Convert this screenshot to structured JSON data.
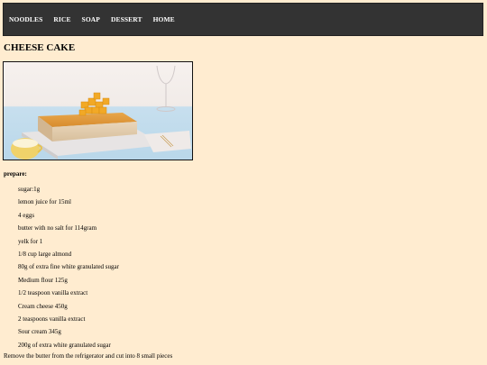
{
  "nav": {
    "items": [
      "NOODLES",
      "RICE",
      "SOAP",
      "DESSERT",
      "HOME"
    ]
  },
  "page": {
    "title": "CHEESE CAKE",
    "image_alt": "cheese cake with mango cubes on a marble board"
  },
  "prepare": {
    "label": "prepare:",
    "ingredients": [
      "sugar:1g",
      "lemon juice for 15ml",
      "4 eggs",
      "butter with no salt for 114gram",
      "yelk for 1",
      "1/8 cup large almond",
      "80g of extra fine white granulated sugar",
      "Medium flour 125g",
      "1/2 teaspoon vanilla extract",
      "Cream cheese 450g",
      "2 teaspoons vanilla extract",
      "Sour cream 345g",
      "200g of extra white granulated sugar"
    ],
    "step": "Remove the butter from the refrigerator and cut into 8 small pieces"
  }
}
